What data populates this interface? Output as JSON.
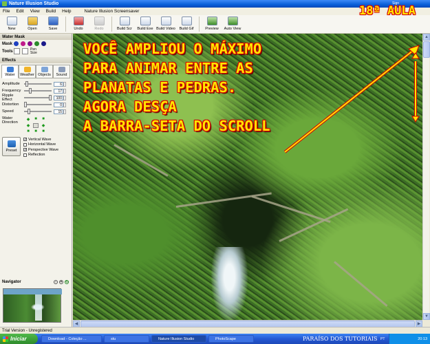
{
  "window": {
    "title": "Nature Illusion Studio",
    "doc_title": "Nature Illusion Screensaver",
    "header_right": "Sign"
  },
  "menu": [
    "File",
    "Edit",
    "View",
    "Build",
    "Help"
  ],
  "toolbar": [
    {
      "label": "New",
      "icon": "new-file-icon"
    },
    {
      "label": "Open",
      "icon": "folder-icon"
    },
    {
      "label": "Save",
      "icon": "save-icon"
    },
    {
      "label": "Undo",
      "icon": "undo-icon"
    },
    {
      "label": "Redo",
      "icon": "redo-icon"
    },
    {
      "label": "Build Scr",
      "icon": "build-icon"
    },
    {
      "label": "Build Exe",
      "icon": "build-icon"
    },
    {
      "label": "Build Video",
      "icon": "video-icon"
    },
    {
      "label": "Build Gif",
      "icon": "gif-icon"
    },
    {
      "label": "Preview",
      "icon": "preview-icon"
    },
    {
      "label": "Auto View",
      "icon": "auto-view-icon"
    }
  ],
  "water_mask": {
    "title": "Water Mask",
    "mask_label": "Mask",
    "tools_label": "Tools",
    "pen_label": "Pen",
    "size_label": "Size",
    "mask_colors": [
      "#1d3fbf",
      "#c01a8a",
      "#8a0a8a",
      "#2a8a2a",
      "#1a1a8a"
    ]
  },
  "effects": {
    "title": "Effects",
    "tabs": [
      "Water",
      "Weather",
      "Objects",
      "Sound"
    ],
    "sliders": [
      {
        "label": "Amplitude",
        "value": "6",
        "level": 0.05
      },
      {
        "label": "Frequency",
        "value": "17",
        "level": 0.2
      },
      {
        "label": "Ripple Effect",
        "value": "100",
        "level": 1.0
      },
      {
        "label": "Distortion",
        "value": "0",
        "level": 0.0
      },
      {
        "label": "Speed",
        "value": "15",
        "level": 0.15
      }
    ],
    "direction_label": "Water Direction",
    "preset_label": "Preset",
    "checkboxes": [
      {
        "label": "Vertical Wave",
        "checked": "✓"
      },
      {
        "label": "Horizontal Wave",
        "checked": ""
      },
      {
        "label": "Perspective Wave",
        "checked": "✓"
      },
      {
        "label": "Reflection",
        "checked": ""
      }
    ]
  },
  "navigator": {
    "title": "Navigator"
  },
  "overlay": {
    "lines": [
      "VOCÊ AMPLIOU O MÁXIMO",
      "PARA  ANIMAR ENTRE AS",
      "PLANATAS E PEDRAS.",
      "AGORA DESÇA",
      "A BARRA-SETA DO SCROLL"
    ],
    "badge": "18ª AULA"
  },
  "status": {
    "text": "Trial Version - Unregistered"
  },
  "taskbar": {
    "start": "Iniciar",
    "tasks": [
      "Download - Coleção ...",
      "stu",
      "Nature Illusion Studio",
      "PhotoScape"
    ],
    "watermark": "PARAÍSO DOS TUTORIAIS",
    "lang": "PT",
    "clock": "20:13"
  }
}
